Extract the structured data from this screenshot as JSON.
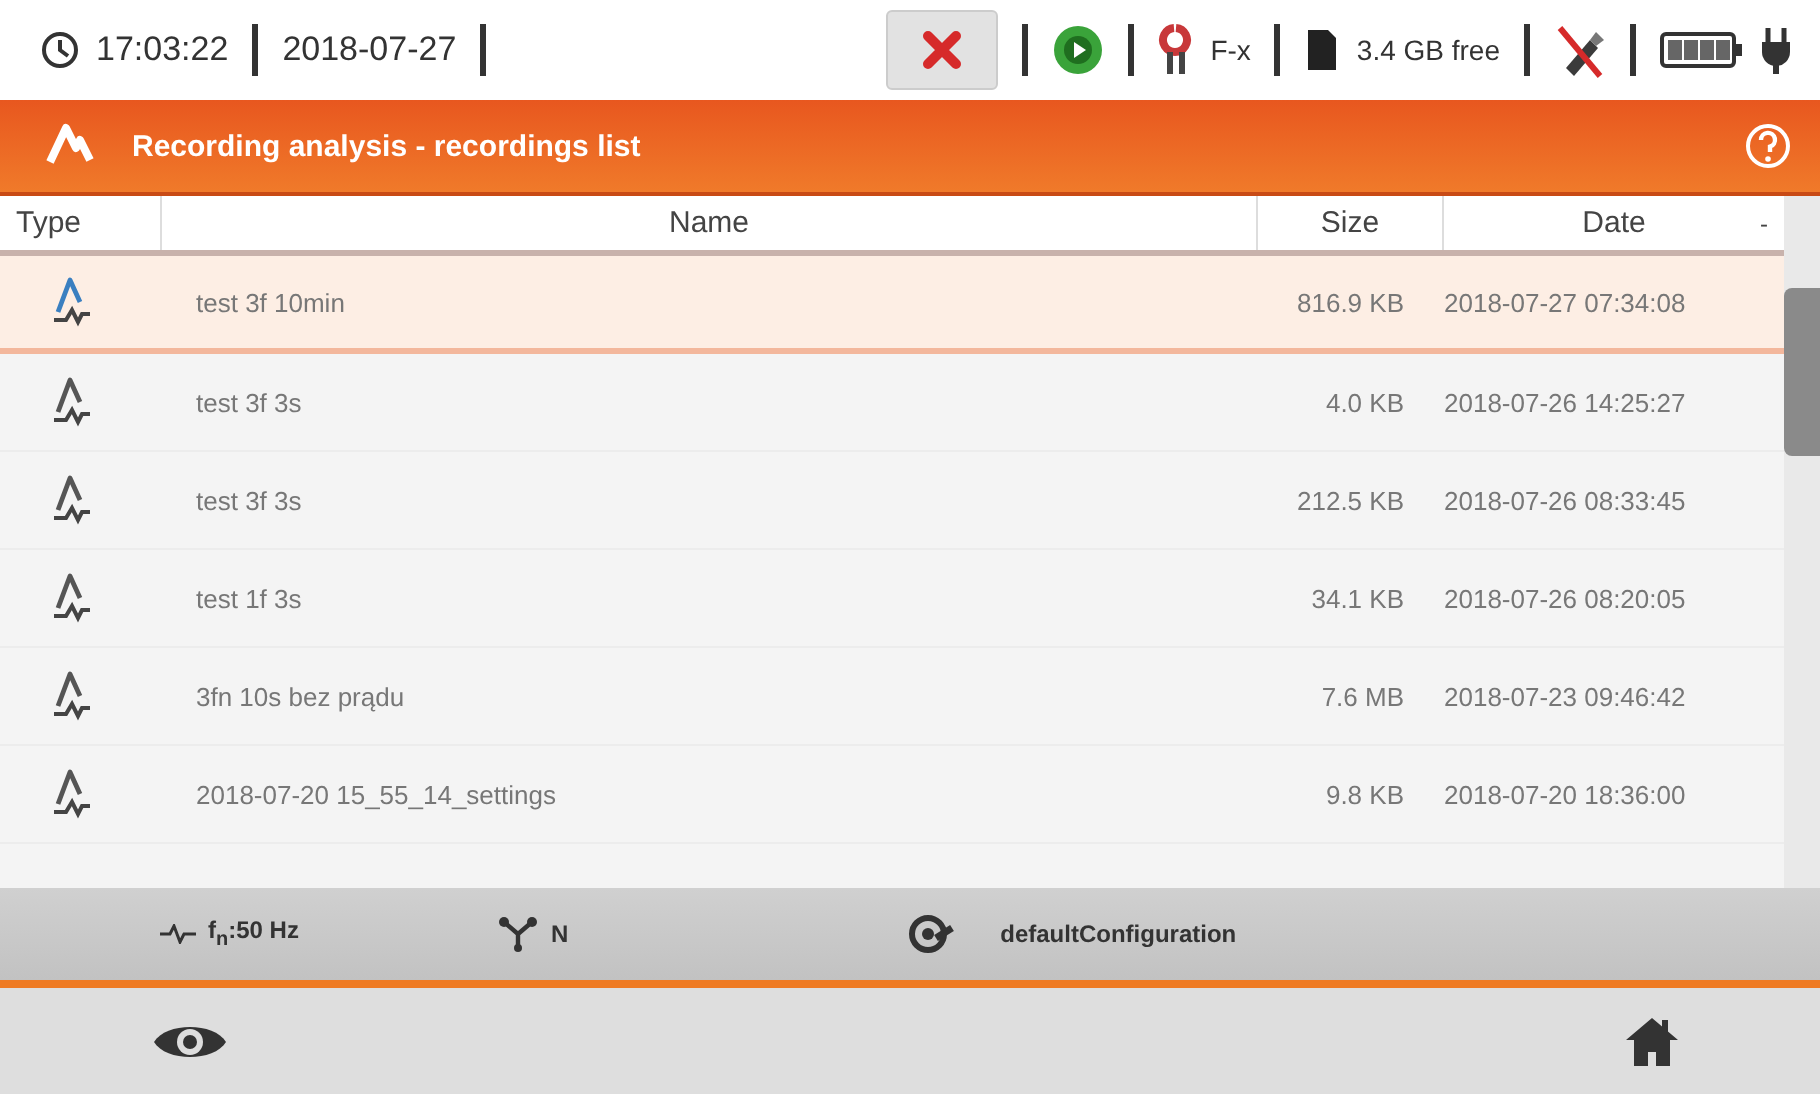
{
  "status_bar": {
    "time": "17:03:22",
    "date": "2018-07-27",
    "clamp_label": "F-x",
    "storage": "3.4 GB free"
  },
  "header": {
    "title": "Recording analysis - recordings list"
  },
  "table": {
    "columns": [
      "Type",
      "Name",
      "Size",
      "Date"
    ],
    "sort_mark": "-",
    "rows": [
      {
        "name": "test 3f 10min",
        "size": "816.9 KB",
        "date": "2018-07-27 07:34:08",
        "selected": true
      },
      {
        "name": "test 3f 3s",
        "size": "4.0 KB",
        "date": "2018-07-26 14:25:27",
        "selected": false
      },
      {
        "name": "test 3f 3s",
        "size": "212.5 KB",
        "date": "2018-07-26 08:33:45",
        "selected": false
      },
      {
        "name": "test 1f 3s",
        "size": "34.1 KB",
        "date": "2018-07-26 08:20:05",
        "selected": false
      },
      {
        "name": "3fn 10s bez prądu",
        "size": "7.6 MB",
        "date": "2018-07-23 09:46:42",
        "selected": false
      },
      {
        "name": "2018-07-20 15_55_14_settings",
        "size": "9.8 KB",
        "date": "2018-07-20 18:36:00",
        "selected": false
      }
    ]
  },
  "info_bar": {
    "frequency": "f$_{n}$:50 Hz",
    "network": "N",
    "configuration": "defaultConfiguration"
  }
}
